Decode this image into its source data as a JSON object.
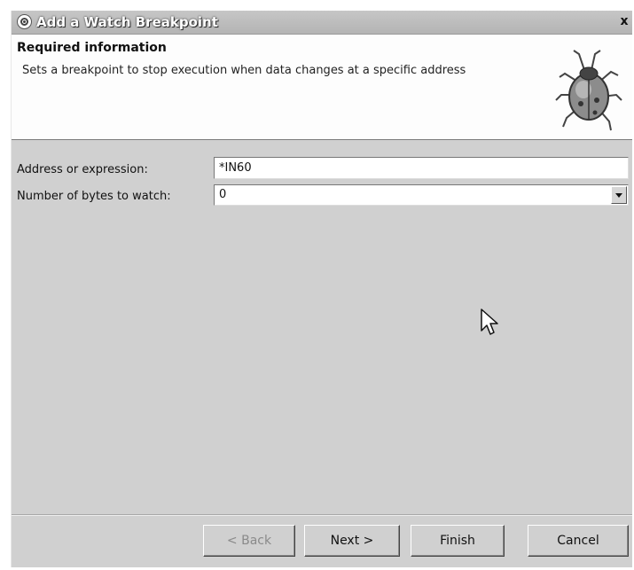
{
  "window": {
    "title": "Add a Watch Breakpoint",
    "close_label": "x"
  },
  "banner": {
    "title": "Required information",
    "description": "Sets a breakpoint to stop execution when data changes at a specific address",
    "image_icon": "ladybug-icon"
  },
  "form": {
    "address_label": "Address or expression:",
    "address_value": "*IN60",
    "bytes_label": "Number of bytes to watch:",
    "bytes_value": "0"
  },
  "buttons": {
    "back_label": "< Back",
    "next_label": "Next >",
    "finish_label": "Finish",
    "cancel_label": "Cancel"
  },
  "colors": {
    "dialog_bg": "#d0d0d0",
    "banner_bg": "#fdfdfd"
  }
}
